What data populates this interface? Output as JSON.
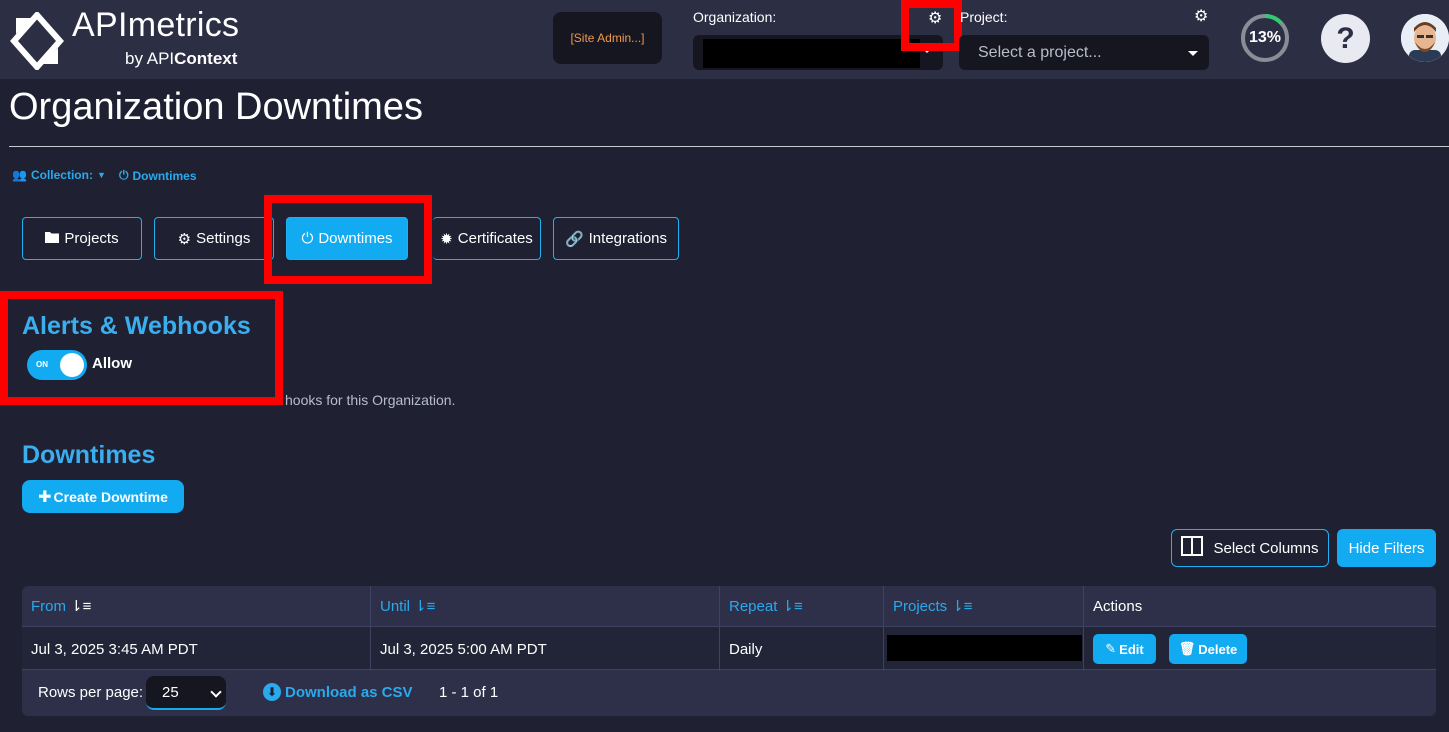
{
  "brand": {
    "title": "APImetrics",
    "by": "by API",
    "context": "Context"
  },
  "header": {
    "site_admin": "[Site Admin...]",
    "organization_label": "Organization:",
    "project_label": "Project:",
    "project_placeholder": "Select a project...",
    "progress_text": "13%",
    "progress_value": 0.13,
    "help_label": "?"
  },
  "page": {
    "title": "Organization Downtimes"
  },
  "breadcrumb": {
    "collection": "Collection:",
    "downtimes": "Downtimes"
  },
  "tabs": [
    {
      "label": "Projects",
      "icon": "folder-icon"
    },
    {
      "label": "Settings",
      "icon": "gear-icon"
    },
    {
      "label": "Downtimes",
      "icon": "power-icon",
      "active": true
    },
    {
      "label": "Certificates",
      "icon": "certificate-icon"
    },
    {
      "label": "Integrations",
      "icon": "link-icon"
    }
  ],
  "alerts": {
    "title": "Alerts & Webhooks",
    "toggle_state": "ON",
    "toggle_label": "Allow",
    "description": "hooks for this Organization."
  },
  "downtimes": {
    "title": "Downtimes",
    "create_label": "Create Downtime",
    "select_columns": "Select Columns",
    "hide_filters": "Hide Filters",
    "columns": [
      "From",
      "Until",
      "Repeat",
      "Projects",
      "Actions"
    ],
    "rows": [
      {
        "from": "Jul 3, 2025 3:45 AM PDT",
        "until": "Jul 3, 2025 5:00 AM PDT",
        "repeat": "Daily",
        "edit": "Edit",
        "delete": "Delete"
      }
    ],
    "rows_per_page_label": "Rows per page:",
    "rows_per_page": "25",
    "download": "Download as CSV",
    "range": "1 - 1 of 1"
  },
  "colors": {
    "accent": "#12aaf1",
    "highlight": "#ff0000",
    "background": "#1f2133"
  }
}
